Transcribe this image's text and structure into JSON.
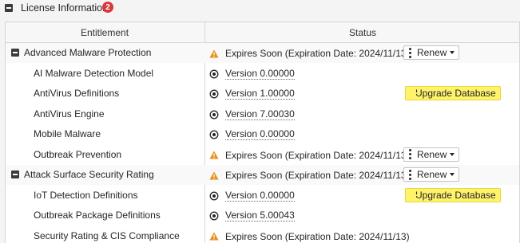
{
  "section": {
    "title": "License Information",
    "badge": "2"
  },
  "table": {
    "headers": {
      "entitlement": "Entitlement",
      "status": "Status"
    }
  },
  "rows": [
    {
      "name": "Advanced Malware Protection",
      "group": true,
      "status_icon": "warning-icon",
      "status": "Expires Soon (Expiration Date: 2024/11/13)",
      "action": "Renew"
    },
    {
      "name": "AI Malware Detection Model",
      "group": false,
      "status_icon": "version-icon",
      "status": "Version 0.00000",
      "action": ""
    },
    {
      "name": "AntiVirus Definitions",
      "group": false,
      "status_icon": "version-icon",
      "status": "Version 1.00000",
      "action": "Upgrade Database"
    },
    {
      "name": "AntiVirus Engine",
      "group": false,
      "status_icon": "version-icon",
      "status": "Version 7.00030",
      "action": ""
    },
    {
      "name": "Mobile Malware",
      "group": false,
      "status_icon": "version-icon",
      "status": "Version 0.00000",
      "action": ""
    },
    {
      "name": "Outbreak Prevention",
      "group": false,
      "status_icon": "warning-icon",
      "status": "Expires Soon (Expiration Date: 2024/11/13)",
      "action": "Renew"
    },
    {
      "name": "Attack Surface Security Rating",
      "group": true,
      "status_icon": "warning-icon",
      "status": "Expires Soon (Expiration Date: 2024/11/13)",
      "action": "Renew"
    },
    {
      "name": "IoT Detection Definitions",
      "group": false,
      "status_icon": "version-icon",
      "status": "Version 0.00000",
      "action": "Upgrade Database"
    },
    {
      "name": "Outbreak Package Definitions",
      "group": false,
      "status_icon": "version-icon",
      "status": "Version 5.00043",
      "action": ""
    },
    {
      "name": "Security Rating & CIS Compliance",
      "group": false,
      "status_icon": "warning-icon",
      "status": "Expires Soon (Expiration Date: 2024/11/13)",
      "action": ""
    }
  ],
  "colors": {
    "warning": "#e8901c",
    "badge": "#d63a3a",
    "highlight": "#fff36b"
  }
}
